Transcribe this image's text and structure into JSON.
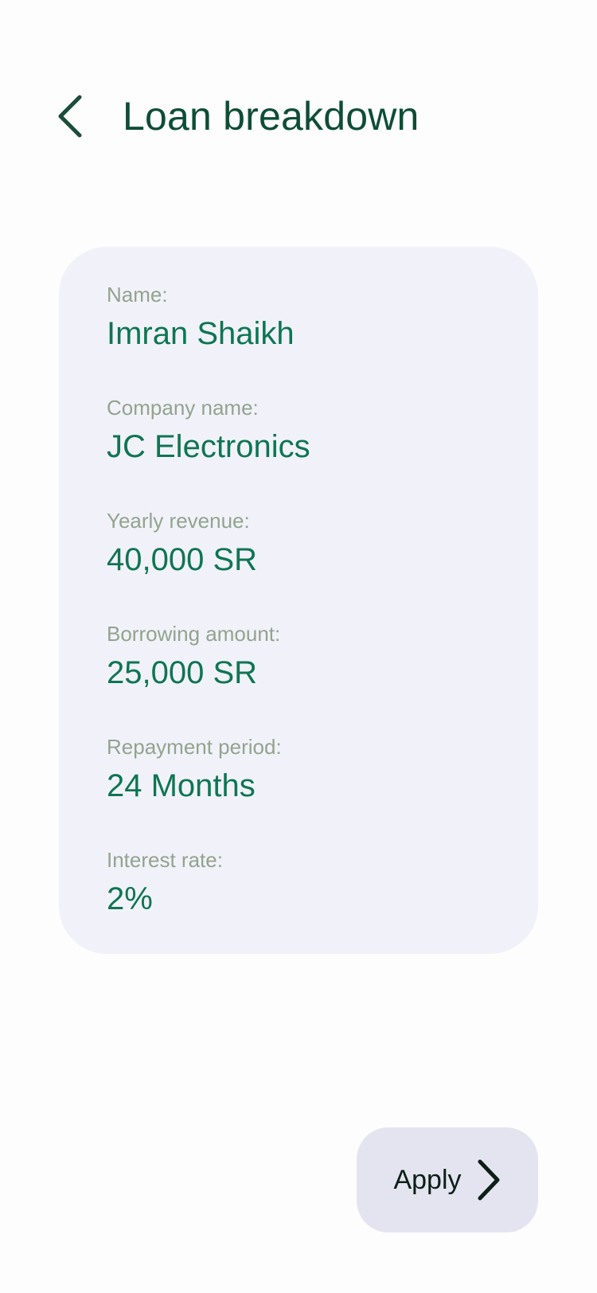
{
  "header": {
    "title": "Loan breakdown",
    "back_icon": "chevron-left-icon"
  },
  "card": {
    "fields": [
      {
        "label": "Name:",
        "value": "Imran Shaikh"
      },
      {
        "label": "Company name:",
        "value": "JC Electronics"
      },
      {
        "label": "Yearly revenue:",
        "value": "40,000 SR"
      },
      {
        "label": "Borrowing amount:",
        "value": "25,000 SR"
      },
      {
        "label": "Repayment period:",
        "value": "24 Months"
      },
      {
        "label": "Interest rate:",
        "value": "2%"
      }
    ]
  },
  "apply_button": {
    "label": "Apply",
    "icon": "chevron-right-icon"
  },
  "colors": {
    "title": "#0e4d36",
    "value_text": "#0f7552",
    "label_text": "#93a38e",
    "card_bg": "#f1f2f9",
    "button_bg": "#e4e4f0"
  }
}
